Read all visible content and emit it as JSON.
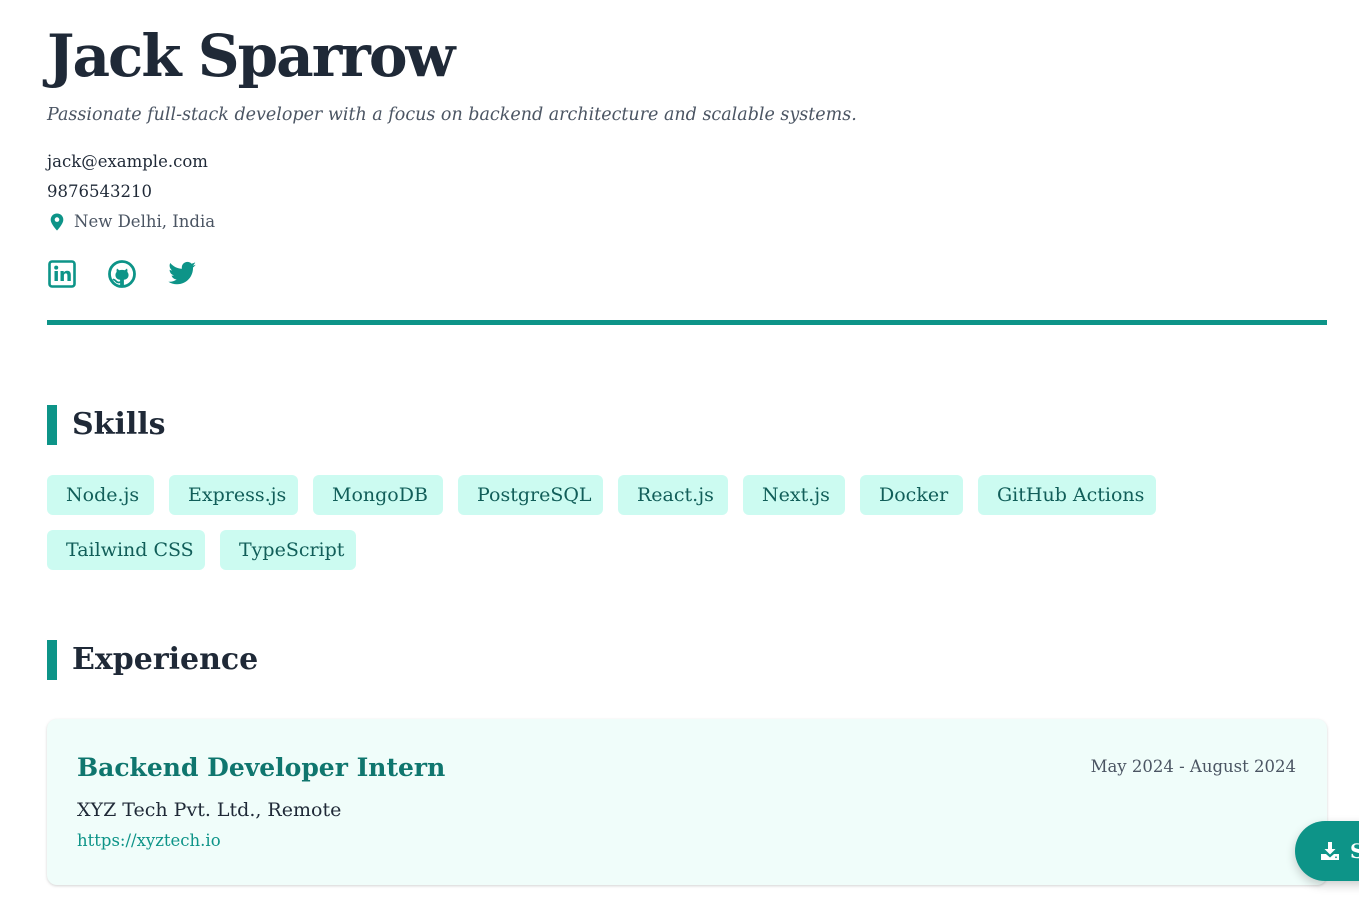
{
  "profile": {
    "name": "Jack Sparrow",
    "tagline": "Passionate full-stack developer with a focus on backend architecture and scalable systems.",
    "email": "jack@example.com",
    "phone": "9876543210",
    "location": "New Delhi, India"
  },
  "socials": [
    {
      "icon": "linkedin-icon"
    },
    {
      "icon": "github-icon"
    },
    {
      "icon": "twitter-icon"
    }
  ],
  "colors": {
    "accent": "#0d9488",
    "tag_bg": "#ccfbf1",
    "tag_text": "#115e59",
    "card_bg": "#f0fdfa",
    "heading": "#1f2937"
  },
  "skills": {
    "heading": "Skills",
    "items": [
      "Node.js",
      "Express.js",
      "MongoDB",
      "PostgreSQL",
      "React.js",
      "Next.js",
      "Docker",
      "GitHub Actions",
      "Tailwind CSS",
      "TypeScript"
    ]
  },
  "experience": {
    "heading": "Experience",
    "items": [
      {
        "title": "Backend Developer Intern",
        "dates": "May 2024 - August 2024",
        "company": "XYZ Tech Pvt. Ltd., Remote",
        "link": "https://xyztech.io"
      }
    ]
  },
  "fab": {
    "icon": "download-icon",
    "label": "S"
  }
}
